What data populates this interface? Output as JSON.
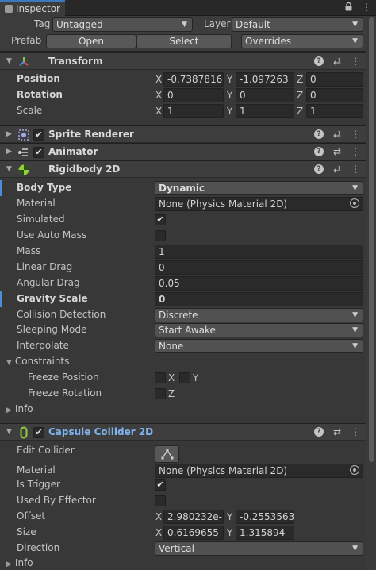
{
  "tab": {
    "label": "Inspector"
  },
  "header": {
    "tag_label": "Tag",
    "tag_value": "Untagged",
    "layer_label": "Layer",
    "layer_value": "Default",
    "prefab_label": "Prefab",
    "open_label": "Open",
    "select_label": "Select",
    "overrides_label": "Overrides"
  },
  "transform": {
    "title": "Transform",
    "position": {
      "label": "Position",
      "x": "-0.7387816",
      "y": "-1.097263",
      "z": "0"
    },
    "rotation": {
      "label": "Rotation",
      "x": "0",
      "y": "0",
      "z": "0"
    },
    "scale": {
      "label": "Scale",
      "x": "1",
      "y": "1",
      "z": "1"
    }
  },
  "axes": {
    "x": "X",
    "y": "Y",
    "z": "Z"
  },
  "sprite_renderer": {
    "title": "Sprite Renderer"
  },
  "animator": {
    "title": "Animator"
  },
  "rigidbody": {
    "title": "Rigidbody 2D",
    "body_type": {
      "label": "Body Type",
      "value": "Dynamic"
    },
    "material": {
      "label": "Material",
      "value": "None (Physics Material 2D)"
    },
    "simulated": {
      "label": "Simulated"
    },
    "use_auto_mass": {
      "label": "Use Auto Mass"
    },
    "mass": {
      "label": "Mass",
      "value": "1"
    },
    "linear_drag": {
      "label": "Linear Drag",
      "value": "0"
    },
    "angular_drag": {
      "label": "Angular Drag",
      "value": "0.05"
    },
    "gravity_scale": {
      "label": "Gravity Scale",
      "value": "0"
    },
    "collision_detection": {
      "label": "Collision Detection",
      "value": "Discrete"
    },
    "sleeping_mode": {
      "label": "Sleeping Mode",
      "value": "Start Awake"
    },
    "interpolate": {
      "label": "Interpolate",
      "value": "None"
    },
    "constraints": {
      "label": "Constraints"
    },
    "freeze_position": {
      "label": "Freeze Position"
    },
    "freeze_rotation": {
      "label": "Freeze Rotation"
    },
    "info": {
      "label": "Info"
    }
  },
  "capsule": {
    "title": "Capsule Collider 2D",
    "edit_collider": {
      "label": "Edit Collider"
    },
    "material": {
      "label": "Material",
      "value": "None (Physics Material 2D)"
    },
    "is_trigger": {
      "label": "Is Trigger"
    },
    "used_by_effector": {
      "label": "Used By Effector"
    },
    "offset": {
      "label": "Offset",
      "x": "2.980232e-",
      "y": "-0.2553563"
    },
    "size": {
      "label": "Size",
      "x": "0.6169655",
      "y": "1.315894"
    },
    "direction": {
      "label": "Direction",
      "value": "Vertical"
    },
    "info": {
      "label": "Info"
    }
  },
  "icons": {
    "check": "✔",
    "triangle_down": "▼",
    "triangle_right": "▶",
    "dropdown_arrow": "▼",
    "kebab": "⋮",
    "lock": "🔒",
    "presets": "⇄",
    "help": "?"
  },
  "colors": {
    "accent_blue": "#4a8fd6",
    "capsule_title": "#7fb4ee",
    "collider_icon": "#8ed13b"
  }
}
